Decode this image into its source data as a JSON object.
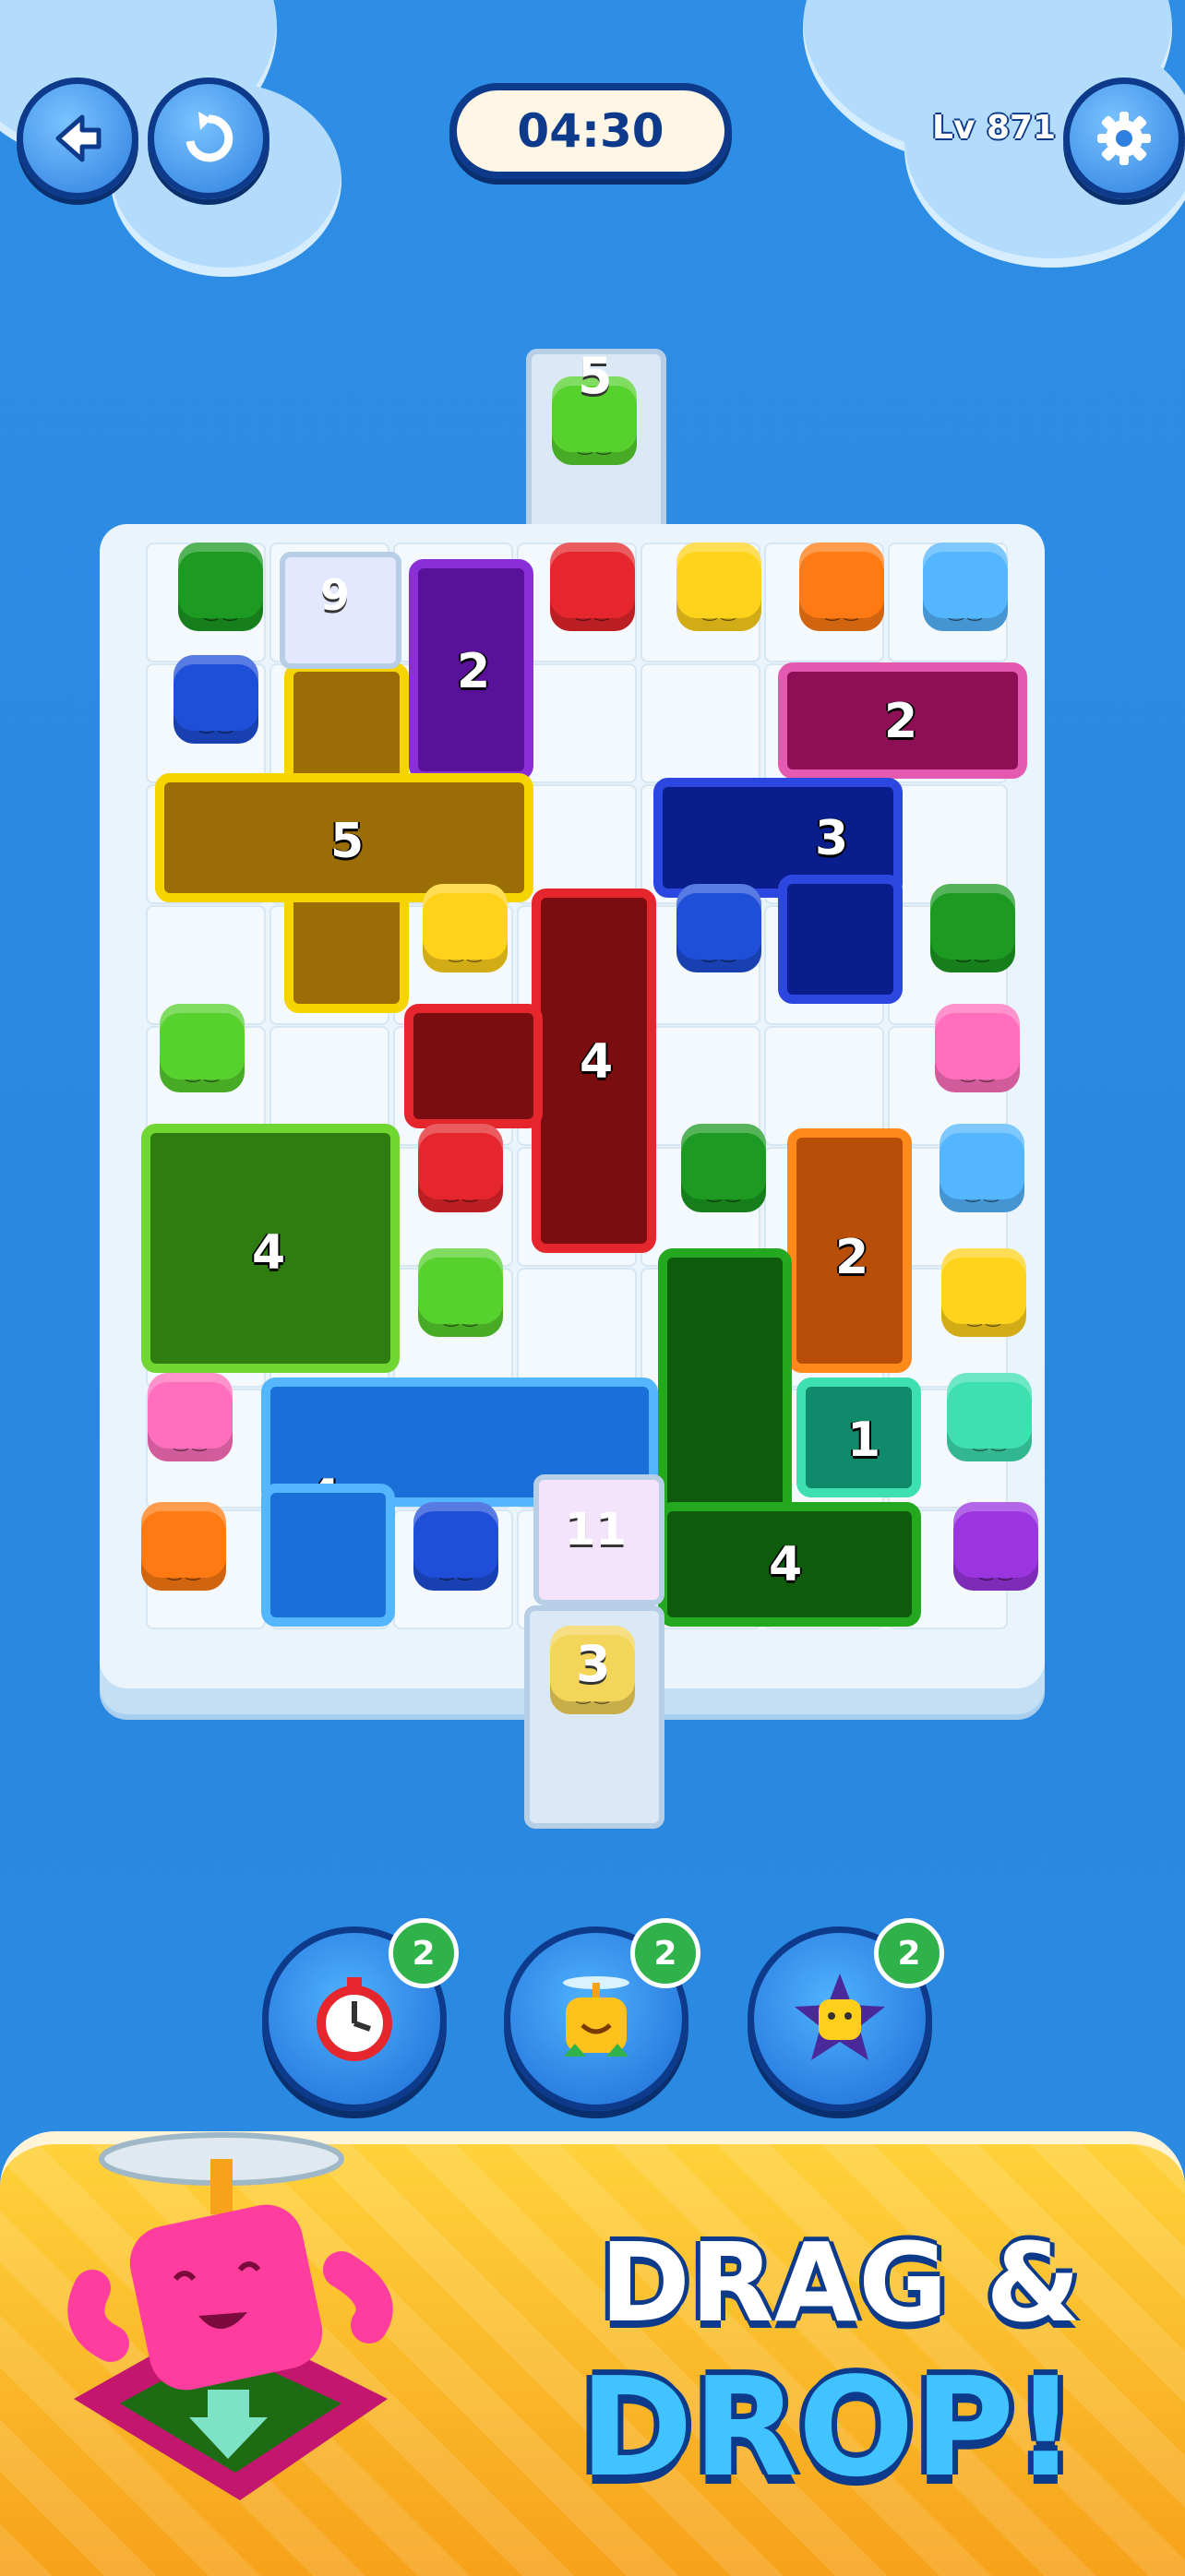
{
  "hud": {
    "timer": "04:30",
    "level": "Lv 871",
    "icons": [
      "back-arrow-icon",
      "restart-icon",
      "gear-icon"
    ]
  },
  "board": {
    "pieces": [
      {
        "name": "purple-piece",
        "color": "#7a1fb8",
        "count": "2"
      },
      {
        "name": "magenta-piece",
        "color": "#c4197a",
        "count": "2"
      },
      {
        "name": "yellow-cross-piece",
        "color": "#f5c500",
        "count": "5"
      },
      {
        "name": "navy-l-piece",
        "color": "#1431b8",
        "count": "3"
      },
      {
        "name": "red-t-piece",
        "color": "#c4161c",
        "count": "4"
      },
      {
        "name": "green-square-piece",
        "color": "#3c9b14",
        "count": "4"
      },
      {
        "name": "orange-piece",
        "color": "#f07a12",
        "count": "2"
      },
      {
        "name": "darkgreen-l-piece",
        "color": "#1f7d16",
        "count": "4"
      },
      {
        "name": "teal-piece",
        "color": "#18b08a",
        "count": "1"
      },
      {
        "name": "blue-u-piece",
        "color": "#2c8ef0",
        "count": "4"
      }
    ],
    "gates": [
      {
        "name": "top-gate",
        "count": "5"
      },
      {
        "name": "bottom-gate",
        "count": "3"
      },
      {
        "name": "frozen-block-top",
        "count": "9"
      },
      {
        "name": "frozen-block-bottom",
        "count": "11"
      }
    ]
  },
  "boosters": [
    {
      "name": "freeze-timer-booster",
      "icon": "stopwatch-icon",
      "count": "2"
    },
    {
      "name": "helicopter-booster",
      "icon": "propeller-cube-icon",
      "count": "2"
    },
    {
      "name": "vacuum-booster",
      "icon": "star-cube-icon",
      "count": "2"
    }
  ],
  "banner": {
    "line1": "DRAG &",
    "line2": "DROP!"
  }
}
